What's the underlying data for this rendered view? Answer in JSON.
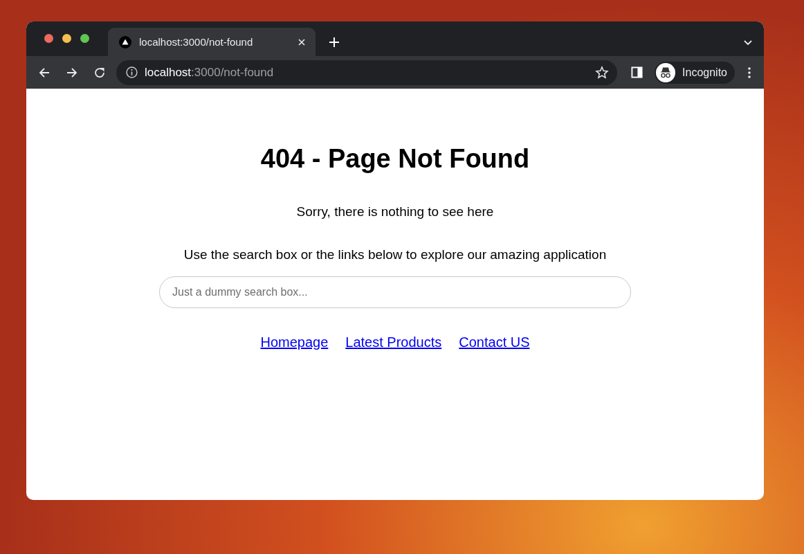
{
  "tabs": [
    {
      "label": "localhost:3000/not-found",
      "selected": true
    }
  ],
  "address_bar": {
    "host": "localhost",
    "path": ":3000/not-found"
  },
  "profile": {
    "label": "Incognito"
  },
  "page": {
    "heading": "404 - Page Not Found",
    "message": "Sorry, there is nothing to see here",
    "hint": "Use the search box or the links below to explore our amazing application",
    "search": {
      "placeholder": "Just a dummy search box..."
    },
    "links": [
      "Homepage",
      "Latest Products",
      "Contact US"
    ]
  }
}
